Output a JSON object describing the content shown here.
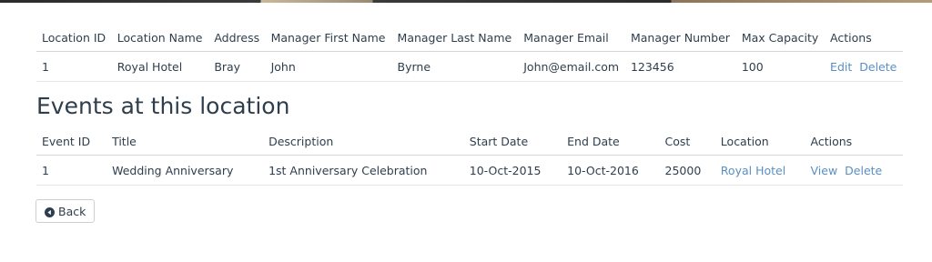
{
  "location_table": {
    "headers": [
      "Location ID",
      "Location Name",
      "Address",
      "Manager First Name",
      "Manager Last Name",
      "Manager Email",
      "Manager Number",
      "Max Capacity",
      "Actions"
    ],
    "row": {
      "id": "1",
      "name": "Royal Hotel",
      "address": "Bray",
      "manager_first": "John",
      "manager_last": "Byrne",
      "manager_email": "John@email.com",
      "manager_number": "123456",
      "max_capacity": "100",
      "edit_label": "Edit",
      "delete_label": "Delete"
    }
  },
  "events_section": {
    "title": "Events at this location"
  },
  "events_table": {
    "headers": [
      "Event ID",
      "Title",
      "Description",
      "Start Date",
      "End Date",
      "Cost",
      "Location",
      "Actions"
    ],
    "row": {
      "id": "1",
      "title": "Wedding Anniversary",
      "description": "1st Anniversary Celebration",
      "start_date": "10-Oct-2015",
      "end_date": "10-Oct-2016",
      "cost": "25000",
      "location": "Royal Hotel",
      "view_label": "View",
      "delete_label": "Delete"
    }
  },
  "back_button": {
    "label": "Back",
    "icon": "arrow-circle-left-icon"
  },
  "colors": {
    "text": "#2f3e4d",
    "link": "#5a8fc4",
    "border": "#d6d6d6"
  }
}
